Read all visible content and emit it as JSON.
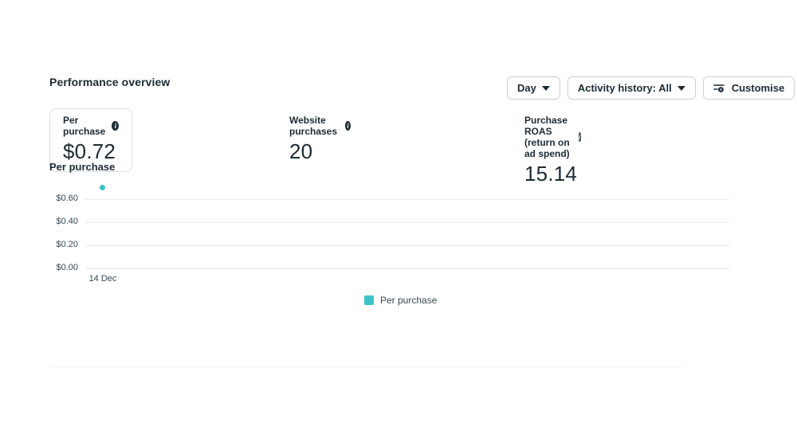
{
  "header": {
    "title": "Performance overview",
    "controls": {
      "day_dropdown": "Day",
      "activity_dropdown": "Activity history: All",
      "customise_button": "Customise"
    }
  },
  "metrics": [
    {
      "label": "Per purchase",
      "value": "$0.72",
      "selected": true,
      "info_icon": "info-icon"
    },
    {
      "label": "Website purchases",
      "value": "20",
      "selected": false,
      "info_icon": "info-icon"
    },
    {
      "label": "Purchase ROAS (return on ad spend)",
      "value": "15.14",
      "selected": false,
      "info_icon": "info-icon"
    }
  ],
  "chart_data": {
    "type": "scatter",
    "title": "Per purchase",
    "x": [
      "14 Dec"
    ],
    "series": [
      {
        "name": "Per purchase",
        "values": [
          0.72
        ]
      }
    ],
    "y_ticks": [
      "$0.60",
      "$0.40",
      "$0.20",
      "$0.00"
    ],
    "ylabel": "",
    "xlabel": "",
    "ylim": [
      0,
      0.8
    ],
    "grid": true,
    "legend_position": "bottom-center",
    "legend": [
      {
        "label": "Per purchase",
        "color": "#3dc2c8"
      }
    ]
  },
  "colors": {
    "accent_teal": "#3dc2c8",
    "text_primary": "#1c2b33",
    "text_secondary": "#344854",
    "card_border": "#dadde1",
    "button_border": "#ccd0d5",
    "gridline": "#e8eaed"
  }
}
